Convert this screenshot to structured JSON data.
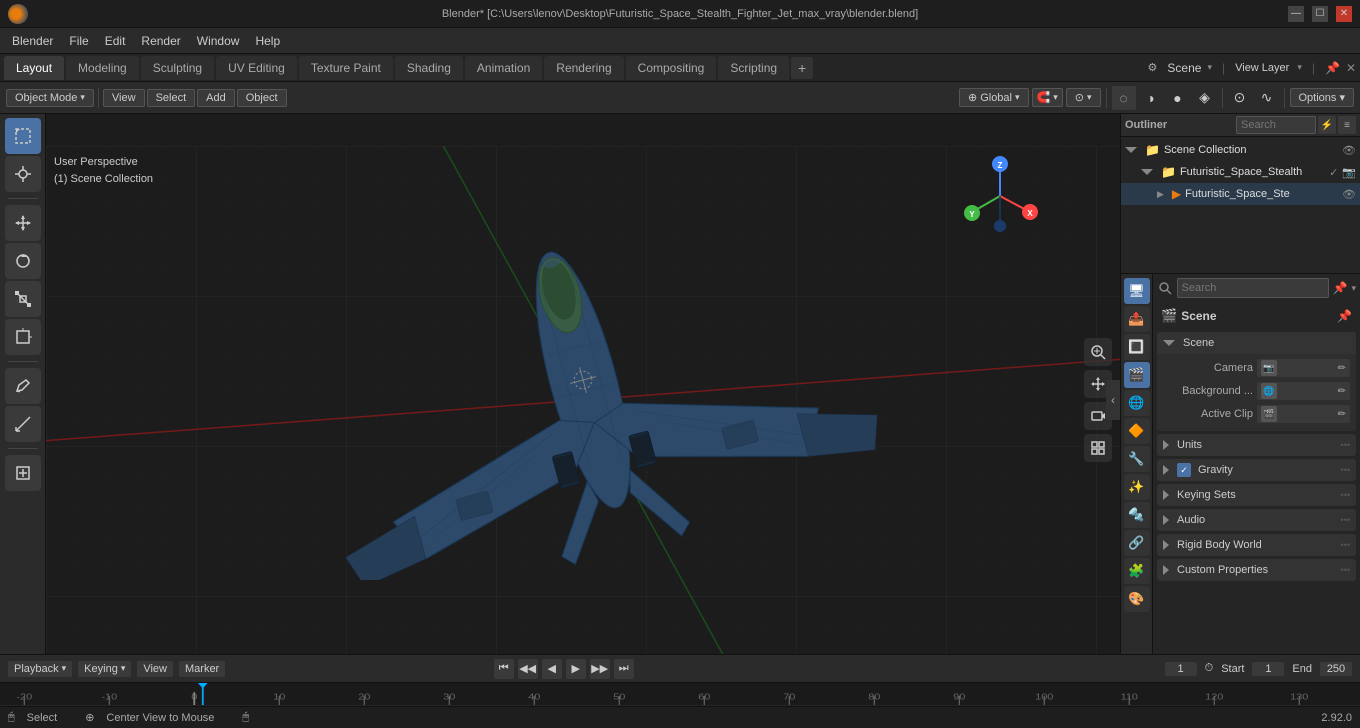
{
  "titlebar": {
    "logo": "blender-logo",
    "title": "Blender* [C:\\Users\\lenov\\Desktop\\Futuristic_Space_Stealth_Fighter_Jet_max_vray\\blender.blend]",
    "min": "—",
    "max": "☐",
    "close": "✕"
  },
  "menubar": {
    "items": [
      "Blender",
      "File",
      "Edit",
      "Render",
      "Window",
      "Help"
    ]
  },
  "workspace_tabs": {
    "tabs": [
      "Layout",
      "Modeling",
      "Sculpting",
      "UV Editing",
      "Texture Paint",
      "Shading",
      "Animation",
      "Rendering",
      "Compositing",
      "Scripting"
    ],
    "active": "Layout",
    "add_label": "+",
    "scene_label": "Scene",
    "view_layer_label": "View Layer"
  },
  "viewport_header": {
    "mode": "Object Mode",
    "view_label": "View",
    "select_label": "Select",
    "add_label": "Add",
    "object_label": "Object",
    "transform": "Global",
    "snap_icon": "🧲",
    "proportional_icon": "⊙",
    "overlay_icon": "⊙",
    "shading_modes": [
      "◌",
      "◑",
      "●",
      "◈"
    ],
    "options_label": "Options ▾"
  },
  "viewport_info": {
    "mode_label": "User Perspective",
    "collection_label": "(1) Scene Collection"
  },
  "right_panel": {
    "outliner": {
      "header": "Outliner",
      "search_placeholder": "Search",
      "items": [
        {
          "label": "Scene Collection",
          "icon": "📁",
          "expanded": true,
          "children": [
            {
              "label": "Futuristic_Space_Stealth",
              "icon": "📁",
              "expanded": true,
              "eye": true,
              "children": [
                {
                  "label": "Futuristic_Space_Ste",
                  "icon": "▶",
                  "camera": true
                }
              ]
            }
          ]
        }
      ]
    },
    "properties": {
      "icon_tabs": [
        "🔧",
        "📷",
        "🌐",
        "🔳",
        "💡",
        "🎨",
        "🔶",
        "🧩",
        "🔩",
        "🌊",
        "🎭"
      ],
      "active_tab": 0,
      "search_placeholder": "Search",
      "title": "Scene",
      "sections": [
        {
          "name": "Scene",
          "expanded": true,
          "rows": [
            {
              "label": "Camera",
              "value": "",
              "has_icon": true
            },
            {
              "label": "Background ...",
              "value": "",
              "has_icon": true
            },
            {
              "label": "Active Clip",
              "value": "",
              "has_icon": true
            }
          ]
        },
        {
          "name": "Units",
          "expanded": false,
          "rows": []
        },
        {
          "name": "Gravity",
          "expanded": false,
          "checkbox": true,
          "rows": []
        },
        {
          "name": "Keying Sets",
          "expanded": false,
          "rows": []
        },
        {
          "name": "Audio",
          "expanded": false,
          "rows": []
        },
        {
          "name": "Rigid Body World",
          "expanded": false,
          "rows": []
        },
        {
          "name": "Custom Properties",
          "expanded": false,
          "rows": []
        }
      ]
    }
  },
  "timeline": {
    "playback_label": "Playback",
    "keying_label": "Keying",
    "view_label": "View",
    "marker_label": "Marker",
    "current_frame": "1",
    "start_label": "Start",
    "start_value": "1",
    "end_label": "End",
    "end_value": "250",
    "play_controls": [
      "⏮",
      "◀◀",
      "◀",
      "▶",
      "▶▶",
      "⏭"
    ]
  },
  "statusbar": {
    "left": "Select",
    "hint": "Center View to Mouse",
    "version": "2.92.0"
  },
  "left_tools": [
    "↖",
    "↔",
    "↻",
    "⬛",
    "🔄",
    "✏",
    "📐",
    "⬜"
  ],
  "viewport_right_tools": [
    "🔍",
    "✋",
    "🎥",
    "⊞"
  ]
}
